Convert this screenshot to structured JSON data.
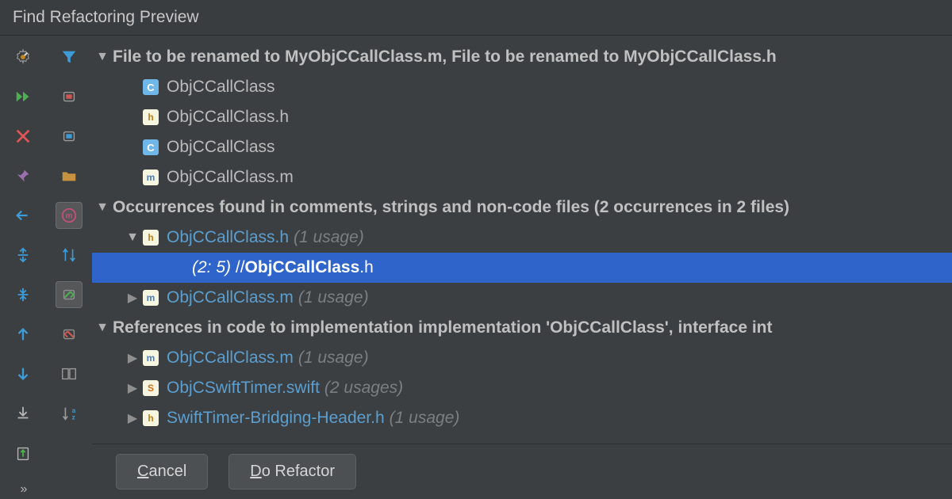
{
  "title": "Find Refactoring Preview",
  "sections": {
    "rename": "File to be renamed to MyObjCCallClass.m, File to be renamed to MyObjCCallClass.h",
    "occurrences": "Occurrences found in comments, strings and non-code files  (2 occurrences in 2 files)",
    "references": "References in code to implementation implementation 'ObjCCallClass', interface int"
  },
  "rename_children": [
    {
      "icon": "c",
      "name": "ObjCCallClass"
    },
    {
      "icon": "h",
      "name": "ObjCCallClass.h"
    },
    {
      "icon": "c",
      "name": "ObjCCallClass"
    },
    {
      "icon": "m",
      "name": "ObjCCallClass.m"
    }
  ],
  "occurrences_children": [
    {
      "icon": "h",
      "name": "ObjCCallClass.h",
      "count": "(1 usage)"
    }
  ],
  "selected_line": {
    "loc": "(2: 5)",
    "prefix": "//  ",
    "bold": "ObjCCallClass",
    "suffix": ".h"
  },
  "occurrences_child2": {
    "icon": "m",
    "name": "ObjCCallClass.m",
    "count": "(1 usage)"
  },
  "references_children": [
    {
      "icon": "m",
      "name": "ObjCCallClass.m",
      "count": "(1 usage)"
    },
    {
      "icon": "s",
      "name": "ObjCSwiftTimer.swift",
      "count": "(2 usages)"
    },
    {
      "icon": "h",
      "name": "SwiftTimer-Bridging-Header.h",
      "count": "(1 usage)"
    }
  ],
  "buttons": {
    "cancel": "ancel",
    "do_refactor": "o Refactor"
  }
}
